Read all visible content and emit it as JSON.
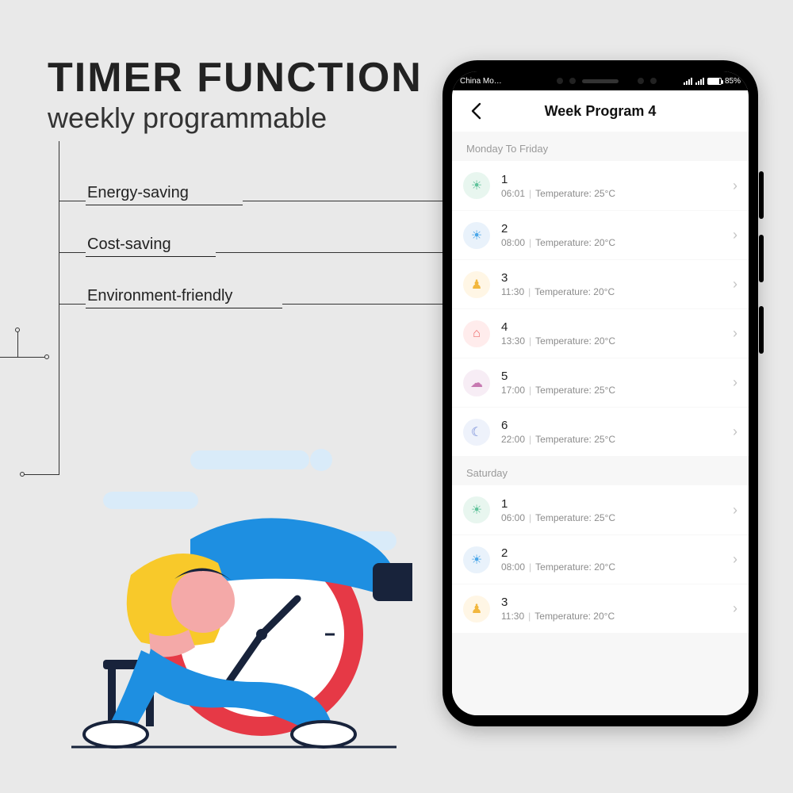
{
  "marketing": {
    "headline": "TIMER FUNCTION",
    "subhead": "weekly programmable",
    "features": [
      "Energy-saving",
      "Cost-saving",
      "Environment-friendly"
    ]
  },
  "statusbar": {
    "carrier": "China Mo…",
    "battery_pct": "85%"
  },
  "app": {
    "title": "Week Program 4",
    "sections": [
      {
        "label": "Monday To Friday",
        "rows": [
          {
            "icon": "sunrise",
            "num": "1",
            "time": "06:01",
            "temp": "Temperature: 25°C"
          },
          {
            "icon": "sun",
            "num": "2",
            "time": "08:00",
            "temp": "Temperature: 20°C"
          },
          {
            "icon": "person",
            "num": "3",
            "time": "11:30",
            "temp": "Temperature: 20°C"
          },
          {
            "icon": "home",
            "num": "4",
            "time": "13:30",
            "temp": "Temperature: 20°C"
          },
          {
            "icon": "cloud",
            "num": "5",
            "time": "17:00",
            "temp": "Temperature: 25°C"
          },
          {
            "icon": "moon",
            "num": "6",
            "time": "22:00",
            "temp": "Temperature: 25°C"
          }
        ]
      },
      {
        "label": "Saturday",
        "rows": [
          {
            "icon": "sunrise",
            "num": "1",
            "time": "06:00",
            "temp": "Temperature: 25°C"
          },
          {
            "icon": "sun",
            "num": "2",
            "time": "08:00",
            "temp": "Temperature: 20°C"
          },
          {
            "icon": "person",
            "num": "3",
            "time": "11:30",
            "temp": "Temperature: 20°C"
          }
        ]
      }
    ]
  },
  "icons": {
    "sunrise": "☀",
    "sun": "☀",
    "person": "♟",
    "home": "⌂",
    "cloud": "☁",
    "moon": "☾"
  }
}
